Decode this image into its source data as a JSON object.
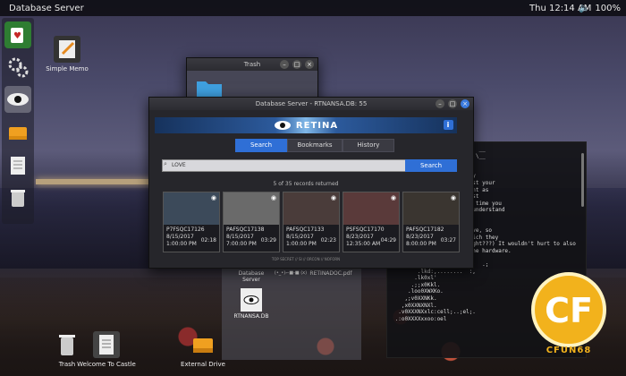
{
  "topbar": {
    "app_name": "Database Server",
    "clock": "Thu 12:14 AM",
    "battery": "100%"
  },
  "dock": {
    "items": [
      {
        "name": "solitaire-icon",
        "active": false
      },
      {
        "name": "settings-gears-icon",
        "active": false
      },
      {
        "name": "eye-icon",
        "active": true
      },
      {
        "name": "drive-icon",
        "active": false
      },
      {
        "name": "notes-icon",
        "active": false
      },
      {
        "name": "trash-icon",
        "active": false
      }
    ]
  },
  "desktop_icons": {
    "simple_memo": "Simple Memo",
    "trash": "Trash",
    "welcome": "Welcome To Castle",
    "external_drive": "External Drive"
  },
  "trash_window": {
    "title": "Trash"
  },
  "retina_window": {
    "title": "Database Server - RTNANSA.DB: 55",
    "brand": "RETINA",
    "info": "i",
    "tabs": [
      {
        "label": "Search",
        "selected": true
      },
      {
        "label": "Bookmarks",
        "selected": false
      },
      {
        "label": "History",
        "selected": false
      }
    ],
    "search": {
      "value": "LOVE",
      "button": "Search"
    },
    "records_text": "5 of 35 records returned",
    "footer_text": "TOP SECRET // SI // ORCON // NOFORN",
    "results": [
      {
        "id": "P7FSQC17126",
        "date": "8/15/2017",
        "time": "1:00:00 PM",
        "duration": "02:18"
      },
      {
        "id": "PAFSQC17138",
        "date": "8/15/2017",
        "time": "7:00:00 PM",
        "duration": "03:29"
      },
      {
        "id": "PAFSQC17133",
        "date": "8/15/2017",
        "time": "1:00:00 PM",
        "duration": "02:23"
      },
      {
        "id": "PSFSQC17170",
        "date": "8/23/2017",
        "time": "12:35:00 AM",
        "duration": "04:29"
      },
      {
        "id": "PAFSQC17182",
        "date": "8/23/2017",
        "time": "8:00:00 PM",
        "duration": "03:27"
      }
    ]
  },
  "terminal": {
    "lines": [
      "  / \\ <    / /\\ \\ \\  /| /  __",
      "  \\ \\ | /  / ___ \\ | \\ /  \\__",
      "  \\_\\_\\ \\_\\/_/   \\_\\_/",
      "",
      "dump of Retina before they",
      "his is what came up against your",
      "this is everything you want as",
      "already partitioned against",
      "es to cover the period of time you",
      "re of the faces -- NOW I understand",
      "stuff!",
      "",
      "t will erase the hard-drive, so",
      "take you into custody (which they",
      "will -- you know this, right???) It wouldn't hurt to also",
      "burn/dissolve/pulverize the hardware.",
      "",
      "         ,,,,,,,,,'toc:;.   .;",
      "        .lkd:,........  :,",
      "       .lk0xl'",
      "      .;;x0Kkl.",
      "     .loo0XWXKo.",
      "    ,;v0XXNKk.",
      "   ,x0XXNXNXl.",
      "  .v0XXXNXxlc:cell;..;el;.",
      " .:o0XXXXxxoo:oel"
    ]
  },
  "files_window": {
    "items": [
      {
        "label": "Database Server"
      },
      {
        "label": "(•_•)⌐■-■ (x)"
      },
      {
        "label": "RETINADOC.pdf"
      },
      {
        "label": "RTNANSA.DB"
      }
    ]
  },
  "logo": {
    "text": "CFUN68"
  }
}
